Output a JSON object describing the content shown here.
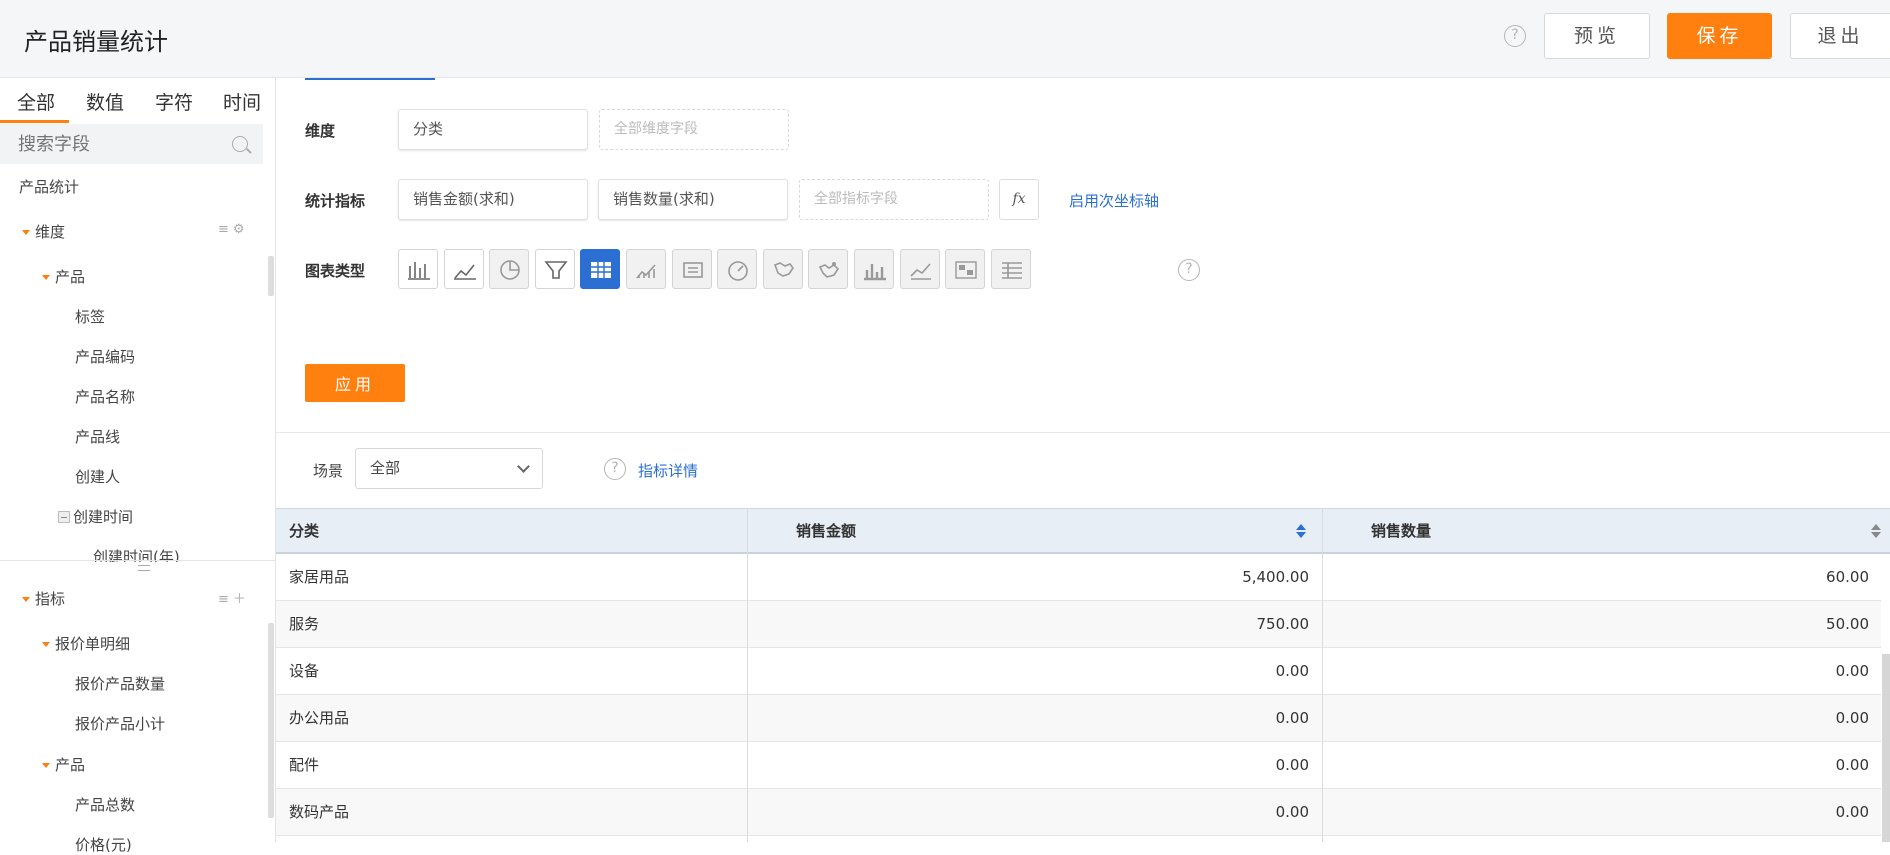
{
  "header": {
    "title": "产品销量统计",
    "preview_label": "预览",
    "save_label": "保存",
    "exit_label": "退出",
    "help_icon": "?"
  },
  "sidebar": {
    "tabs": [
      "全部",
      "数值",
      "字符",
      "时间"
    ],
    "search_placeholder": "搜索字段",
    "root": "产品统计",
    "dimension_section": "维度",
    "dimension_group": "产品",
    "dimension_fields": [
      "标签",
      "产品编码",
      "产品名称",
      "产品线",
      "创建人"
    ],
    "created_time": "创建时间",
    "created_time_year": "创建时间(年)",
    "metric_section": "指标",
    "metric_group_1": "报价单明细",
    "metric_group_1_fields": [
      "报价产品数量",
      "报价产品小计"
    ],
    "metric_group_2": "产品",
    "metric_group_2_fields": [
      "产品总数",
      "价格(元)"
    ]
  },
  "config": {
    "dimension_label": "维度",
    "dimension_chip": "分类",
    "dimension_placeholder": "全部维度字段",
    "metric_label": "统计指标",
    "metric_chips": [
      "销售金额(求和)",
      "销售数量(求和)"
    ],
    "metric_placeholder": "全部指标字段",
    "fx_label": "fx",
    "secondary_axis_link": "启用次坐标轴",
    "chart_type_label": "图表类型",
    "chart_types": [
      "bar-chart-icon",
      "line-chart-icon",
      "pie-chart-icon",
      "funnel-chart-icon",
      "table-chart-icon",
      "area-chart-icon",
      "card-chart-icon",
      "gauge-chart-icon",
      "map-chart-icon",
      "scatter-map-icon",
      "stacked-bar-icon",
      "combo-line-icon",
      "heatmap-icon",
      "pivot-table-icon"
    ],
    "apply_label": "应用"
  },
  "scene": {
    "label": "场景",
    "value": "全部",
    "metric_detail_link": "指标详情"
  },
  "table": {
    "headers": [
      "分类",
      "销售金额",
      "销售数量"
    ],
    "rows": [
      [
        "家居用品",
        "5,400.00",
        "60.00"
      ],
      [
        "服务",
        "750.00",
        "50.00"
      ],
      [
        "设备",
        "0.00",
        "0.00"
      ],
      [
        "办公用品",
        "0.00",
        "0.00"
      ],
      [
        "配件",
        "0.00",
        "0.00"
      ],
      [
        "数码产品",
        "0.00",
        "0.00"
      ]
    ]
  },
  "colors": {
    "accent": "#ff7f0f",
    "link": "#2a6fd1",
    "table_header": "#e8eef6"
  }
}
